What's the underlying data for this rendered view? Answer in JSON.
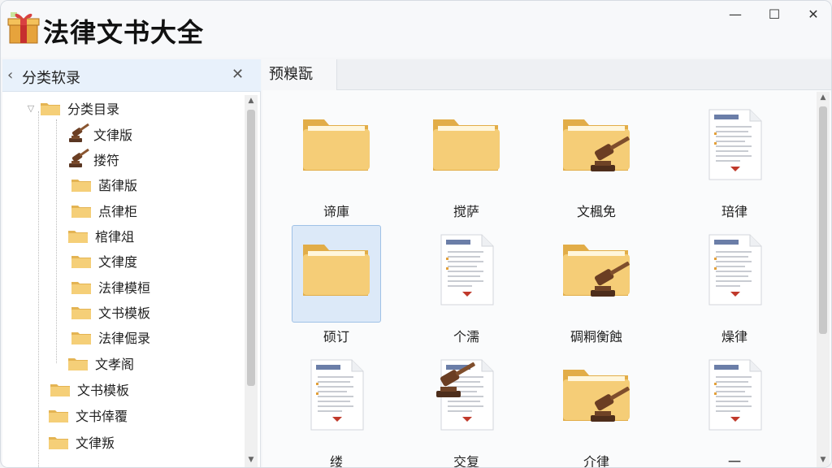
{
  "window": {
    "title": "法律文书大全",
    "minimize": "—",
    "maximize": "☐",
    "close": "✕"
  },
  "sidebar": {
    "title": "分类软录",
    "back_icon": "chevron-left-icon",
    "close_icon": "close-icon",
    "tree": [
      {
        "label": "分类目录",
        "icon": "folder-icon",
        "toggle": "▽"
      },
      {
        "label": "文律版",
        "icon": "gavel-icon",
        "toggle": ""
      },
      {
        "label": "搂符",
        "icon": "gavel-icon",
        "toggle": ""
      },
      {
        "label": "菡律版",
        "icon": "folder-icon",
        "toggle": ""
      },
      {
        "label": "点律柜",
        "icon": "folder-icon",
        "toggle": ""
      },
      {
        "label": "棺律俎",
        "icon": "folder-icon",
        "toggle": ""
      },
      {
        "label": "文律度",
        "icon": "folder-icon",
        "toggle": ""
      },
      {
        "label": "法律模桓",
        "icon": "folder-icon",
        "toggle": ""
      },
      {
        "label": "文书模板",
        "icon": "folder-icon",
        "toggle": ""
      },
      {
        "label": "法律倔录",
        "icon": "folder-icon",
        "toggle": ""
      },
      {
        "label": "文孝阁",
        "icon": "folder-icon",
        "toggle": ""
      },
      {
        "label": "文书模板",
        "icon": "folder-icon",
        "toggle": ""
      },
      {
        "label": "文书倖覆",
        "icon": "folder-icon",
        "toggle": ""
      },
      {
        "label": "文律叛",
        "icon": "folder-icon",
        "toggle": ""
      }
    ]
  },
  "main": {
    "tab": "预糗翫",
    "items": [
      {
        "label": "谛庫",
        "type": "folder"
      },
      {
        "label": "搅萨",
        "type": "folder"
      },
      {
        "label": "文楓免",
        "type": "folder-gavel"
      },
      {
        "label": "琣律",
        "type": "document"
      },
      {
        "label": "硕订",
        "type": "folder",
        "selected": true
      },
      {
        "label": "个濡",
        "type": "document"
      },
      {
        "label": "碉粡衡蝕",
        "type": "folder-gavel"
      },
      {
        "label": "燥律",
        "type": "document"
      },
      {
        "label": "缕",
        "type": "document"
      },
      {
        "label": "交复",
        "type": "document-gavel"
      },
      {
        "label": "介律",
        "type": "folder-gavel"
      },
      {
        "label": "一",
        "type": "document"
      }
    ]
  },
  "colors": {
    "folder": "#f2c86a",
    "folder_dark": "#e0ad45",
    "selection": "#dce9f8",
    "sidebar_head": "#e8f1fb"
  }
}
